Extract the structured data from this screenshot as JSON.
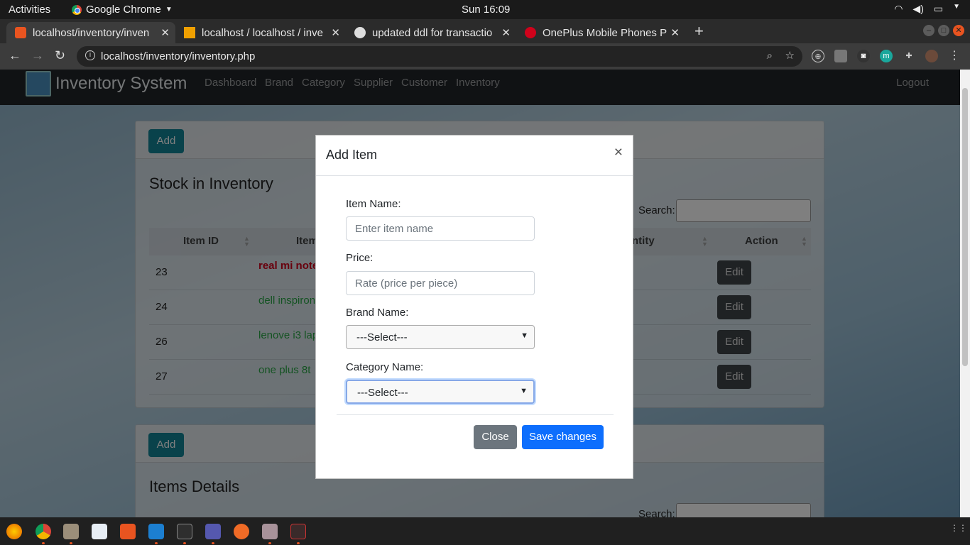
{
  "system": {
    "activities": "Activities",
    "app_name": "Google Chrome",
    "clock": "Sun 16:09"
  },
  "browser": {
    "tabs": [
      {
        "title": "localhost/inventory/inven",
        "favicon_color": "#e95420"
      },
      {
        "title": "localhost / localhost / inve",
        "favicon_color": "#f0a000"
      },
      {
        "title": "updated ddl for transactio",
        "favicon_color": "#dddddd"
      },
      {
        "title": "OnePlus Mobile Phones P",
        "favicon_color": "#d0021b"
      }
    ],
    "url": "localhost/inventory/inventory.php"
  },
  "navbar": {
    "brand": "Inventory System",
    "links": [
      "Dashboard",
      "Brand",
      "Category",
      "Supplier",
      "Customer",
      "Inventory"
    ],
    "logout": "Logout"
  },
  "stock_card": {
    "add_label": "Add",
    "title": "Stock in Inventory",
    "search_label": "Search:",
    "headers": {
      "item_id": "Item ID",
      "item": "Item",
      "quantity": "ntity",
      "action": "Action"
    },
    "rows": [
      {
        "id": "23",
        "name": "real mi note",
        "color": "#d0021b",
        "bold": true,
        "action": "Edit"
      },
      {
        "id": "24",
        "name": "dell inspiron",
        "color": "#28a745",
        "bold": false,
        "action": "Edit"
      },
      {
        "id": "26",
        "name": "lenove i3 lap",
        "color": "#28a745",
        "bold": false,
        "action": "Edit"
      },
      {
        "id": "27",
        "name": "one plus 8t",
        "color": "#28a745",
        "bold": false,
        "action": "Edit"
      }
    ]
  },
  "details_card": {
    "add_label": "Add",
    "title": "Items Details",
    "search_label": "Search:"
  },
  "modal": {
    "title": "Add Item",
    "close_glyph": "×",
    "item_name_label": "Item Name:",
    "item_name_placeholder": "Enter item name",
    "price_label": "Price:",
    "price_placeholder": "Rate (price per piece)",
    "brand_label": "Brand Name:",
    "brand_value": "---Select---",
    "category_label": "Category Name:",
    "category_value": "---Select---",
    "close_button": "Close",
    "save_button": "Save changes"
  }
}
